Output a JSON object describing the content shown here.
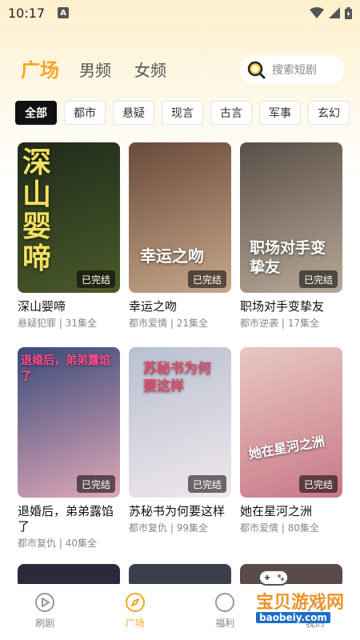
{
  "status_bar": {
    "time": "10:17",
    "notif_letter": "A"
  },
  "header": {
    "tabs": [
      {
        "label": "广场",
        "active": true
      },
      {
        "label": "男频",
        "active": false
      },
      {
        "label": "女频",
        "active": false
      }
    ],
    "search_placeholder": "搜索短剧"
  },
  "categories": [
    {
      "label": "全部",
      "active": true
    },
    {
      "label": "都市"
    },
    {
      "label": "悬疑"
    },
    {
      "label": "现言"
    },
    {
      "label": "古言"
    },
    {
      "label": "军事"
    },
    {
      "label": "玄幻"
    }
  ],
  "dramas": [
    {
      "title": "深山婴啼",
      "genre": "悬疑犯罪",
      "episodes": "31集全",
      "status": "已完结",
      "poster_text": "深山婴啼",
      "colors": [
        "#1f2a1a",
        "#4a5a2a"
      ]
    },
    {
      "title": "幸运之吻",
      "genre": "都市爱情",
      "episodes": "21集全",
      "status": "已完结",
      "poster_text": "幸运之吻",
      "colors": [
        "#6a4a3a",
        "#c8a88a"
      ]
    },
    {
      "title": "职场对手变挚友",
      "genre": "都市逆袭",
      "episodes": "17集全",
      "status": "已完结",
      "poster_text": "职场对手变挚友",
      "colors": [
        "#5a5048",
        "#b8a898"
      ]
    },
    {
      "title": "退婚后，弟弟露馅了",
      "genre": "都市复仇",
      "episodes": "40集全",
      "status": "已完结",
      "poster_text": "退婚后，弟弟露馅了",
      "colors": [
        "#3a4a7a",
        "#e0a8b8"
      ]
    },
    {
      "title": "苏秘书为何要这样",
      "genre": "都市复仇",
      "episodes": "99集全",
      "status": "已完结",
      "poster_text": "苏秘书为何要这样",
      "colors": [
        "#b8c0d0",
        "#f0e8ec"
      ]
    },
    {
      "title": "她在星河之洲",
      "genre": "都市爱情",
      "episodes": "80集全",
      "status": "已完结",
      "poster_text": "她在星河之洲",
      "colors": [
        "#e8c8c0",
        "#c87888"
      ]
    }
  ],
  "bottom_nav": [
    {
      "label": "刷剧",
      "icon": "play-circle-icon",
      "active": false
    },
    {
      "label": "广场",
      "icon": "compass-icon",
      "active": true
    },
    {
      "label": "福利",
      "icon": "gift-icon",
      "active": false
    },
    {
      "label": "我的",
      "icon": "user-icon",
      "active": false
    }
  ],
  "watermark": {
    "text": "宝贝游戏网",
    "url": "baobeiy.com"
  },
  "colors": {
    "accent": "#f5a623",
    "chip_active_bg": "#111111"
  }
}
